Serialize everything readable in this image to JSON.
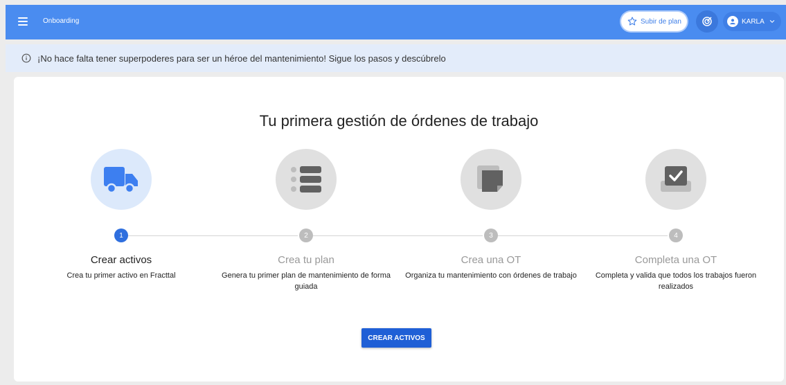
{
  "header": {
    "title": "Onboarding",
    "upgrade_label": "Subir de plan",
    "user_name": "KARLA"
  },
  "banner": {
    "text": "¡No hace falta tener superpoderes para ser un héroe del mantenimiento! Sigue los pasos y descúbrelo"
  },
  "main": {
    "title": "Tu primera gestión de órdenes de trabajo",
    "steps": [
      {
        "number": "1",
        "label": "Crear activos",
        "description": "Crea tu primer activo en Fracttal",
        "icon": "truck-icon",
        "active": true
      },
      {
        "number": "2",
        "label": "Crea tu plan",
        "description": "Genera tu primer plan de mantenimiento de forma guiada",
        "icon": "list-icon",
        "active": false
      },
      {
        "number": "3",
        "label": "Crea una OT",
        "description": "Organiza tu mantenimiento con órdenes de trabajo",
        "icon": "document-stack-icon",
        "active": false
      },
      {
        "number": "4",
        "label": "Completa una OT",
        "description": "Completa y valida que todos los trabajos fueron realizados",
        "icon": "check-box-icon",
        "active": false
      }
    ],
    "cta_label": "CREAR ACTIVOS"
  },
  "colors": {
    "header_bg": "#4a8cf0",
    "accent": "#2f6fde",
    "banner_bg": "#e3ecfa",
    "inactive": "#bdbdbd"
  }
}
